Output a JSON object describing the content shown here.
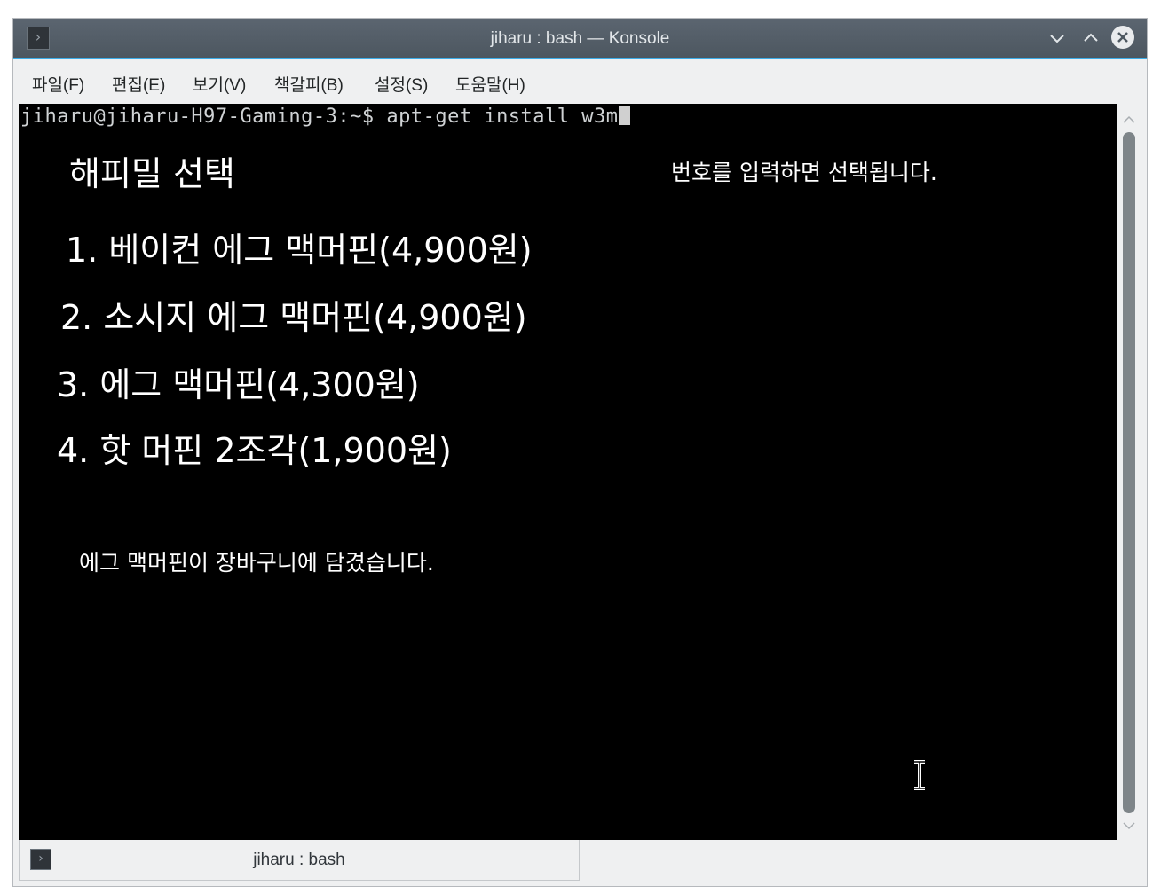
{
  "window": {
    "title": "jiharu : bash — Konsole",
    "app_icon": "terminal-icon",
    "controls": {
      "minimize_icon": "chevron-down-icon",
      "maximize_icon": "chevron-up-icon",
      "close_icon": "close-icon"
    }
  },
  "menubar": {
    "items": [
      {
        "label": "파일(F)"
      },
      {
        "label": "편집(E)"
      },
      {
        "label": "보기(V)"
      },
      {
        "label": "책갈피(B)"
      },
      {
        "label": "설정(S)"
      },
      {
        "label": "도움말(H)"
      }
    ]
  },
  "terminal": {
    "prompt": "jiharu@jiharu-H97-Gaming-3:~$ ",
    "command": "apt-get install w3m",
    "background_color": "#000000",
    "text_color": "#ffffff"
  },
  "overlay": {
    "heading": "해피밀 선택",
    "hint": "번호를 입력하면 선택됩니다.",
    "items": [
      {
        "label": "1. 베이컨 에그 맥머핀(4,900원)"
      },
      {
        "label": "2. 소시지 에그 맥머핀(4,900원)"
      },
      {
        "label": "3. 에그 맥머핀(4,300원)"
      },
      {
        "label": "4. 핫 머핀 2조각(1,900원)"
      }
    ],
    "cart_message": "에그 맥머핀이 장바구니에 담겼습니다."
  },
  "tabs": [
    {
      "label": "jiharu : bash",
      "icon": "terminal-icon"
    }
  ],
  "colors": {
    "titlebar": "#4d5760",
    "accent": "#3daee9",
    "chrome": "#eff0f1"
  }
}
